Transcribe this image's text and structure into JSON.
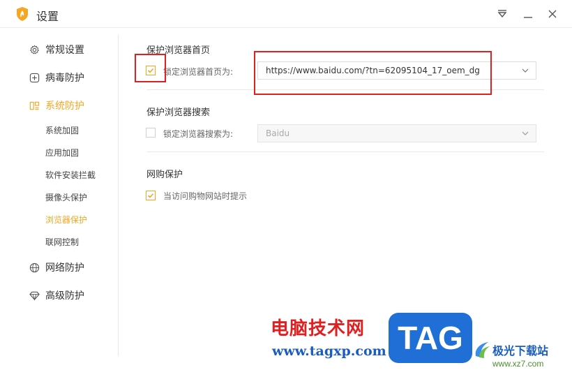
{
  "window": {
    "title": "设置"
  },
  "sidebar": {
    "items": [
      {
        "label": "常规设置"
      },
      {
        "label": "病毒防护"
      },
      {
        "label": "系统防护"
      },
      {
        "label": "网络防护"
      },
      {
        "label": "高级防护"
      }
    ],
    "system_sub_items": [
      {
        "label": "系统加固"
      },
      {
        "label": "应用加固"
      },
      {
        "label": "软件安装拦截"
      },
      {
        "label": "摄像头保护"
      },
      {
        "label": "浏览器保护"
      },
      {
        "label": "联网控制"
      }
    ]
  },
  "main": {
    "homepage": {
      "title": "保护浏览器首页",
      "checkbox_label": "锁定浏览器首页为:",
      "checked": true,
      "value": "https://www.baidu.com/?tn=62095104_17_oem_dg"
    },
    "search": {
      "title": "保护浏览器搜索",
      "checkbox_label": "锁定浏览器搜索为:",
      "checked": false,
      "value": "Baidu"
    },
    "shopping": {
      "title": "网购保护",
      "checkbox_label": "当访问购物网站时提示",
      "checked": true
    }
  },
  "watermark": {
    "cn_text": "电脑技术网",
    "url": "www.tagxp.com",
    "badge": "TAG",
    "site_name": "极光下载站",
    "site_url": "www.xz7.com"
  },
  "colors": {
    "accent": "#f5a623",
    "highlight": "#e02020"
  }
}
